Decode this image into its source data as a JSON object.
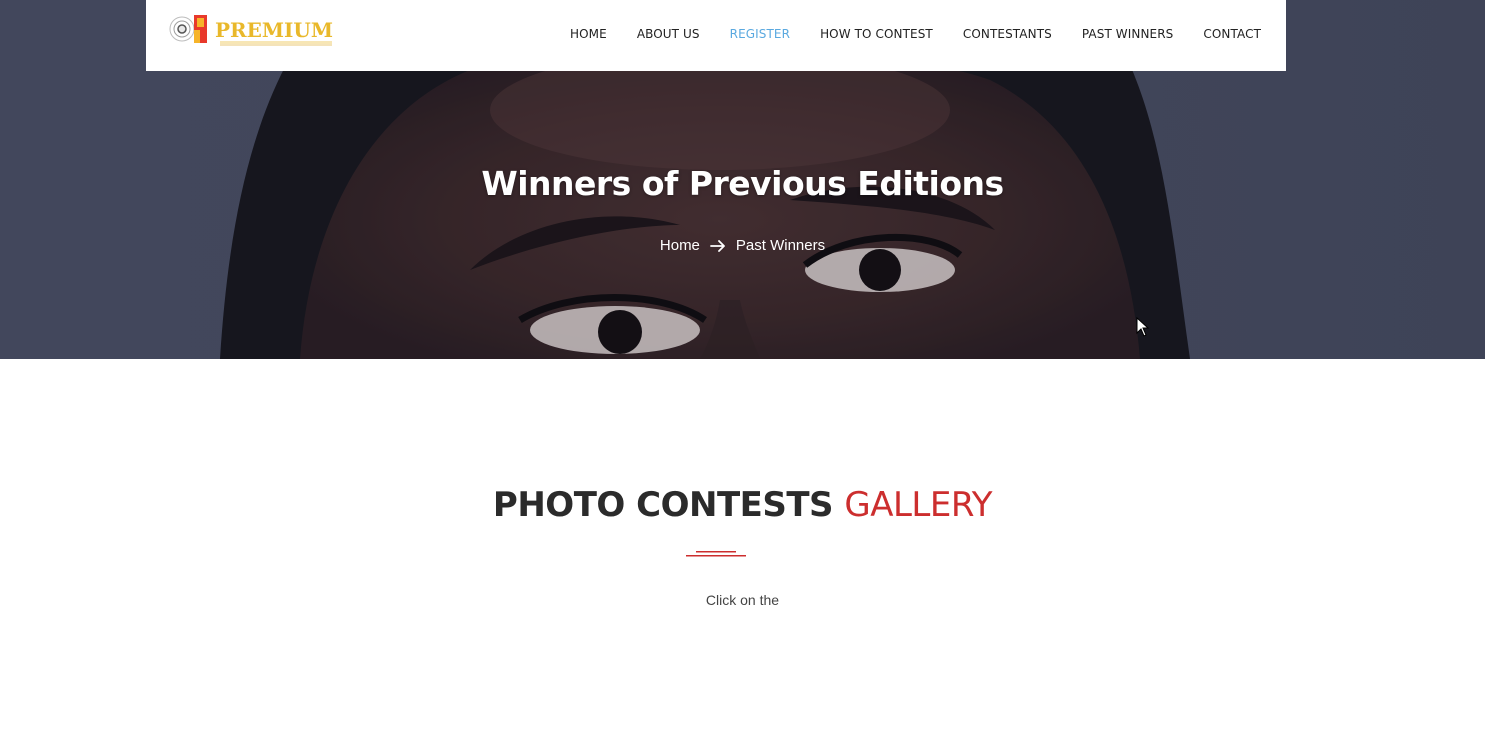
{
  "brand": {
    "name": "PREMIUM",
    "tagline_color": "#e9b82a"
  },
  "nav": {
    "items": [
      {
        "label": "HOME",
        "active": false
      },
      {
        "label": "ABOUT US",
        "active": false
      },
      {
        "label": "REGISTER",
        "active": true
      },
      {
        "label": "HOW TO CONTEST",
        "active": false
      },
      {
        "label": "CONTESTANTS",
        "active": false
      },
      {
        "label": "PAST WINNERS",
        "active": false
      },
      {
        "label": "CONTACT",
        "active": false
      }
    ],
    "active_color": "#5aa9e0"
  },
  "hero": {
    "title": "Winners of Previous Editions",
    "breadcrumb": {
      "home": "Home",
      "current": "Past Winners",
      "separator_icon": "arrow-right-icon"
    }
  },
  "gallery": {
    "title_dark": "PHOTO CONTESTS",
    "title_accent": "GALLERY",
    "accent_color": "#cc2e2e",
    "subtitle": "Click on the"
  }
}
